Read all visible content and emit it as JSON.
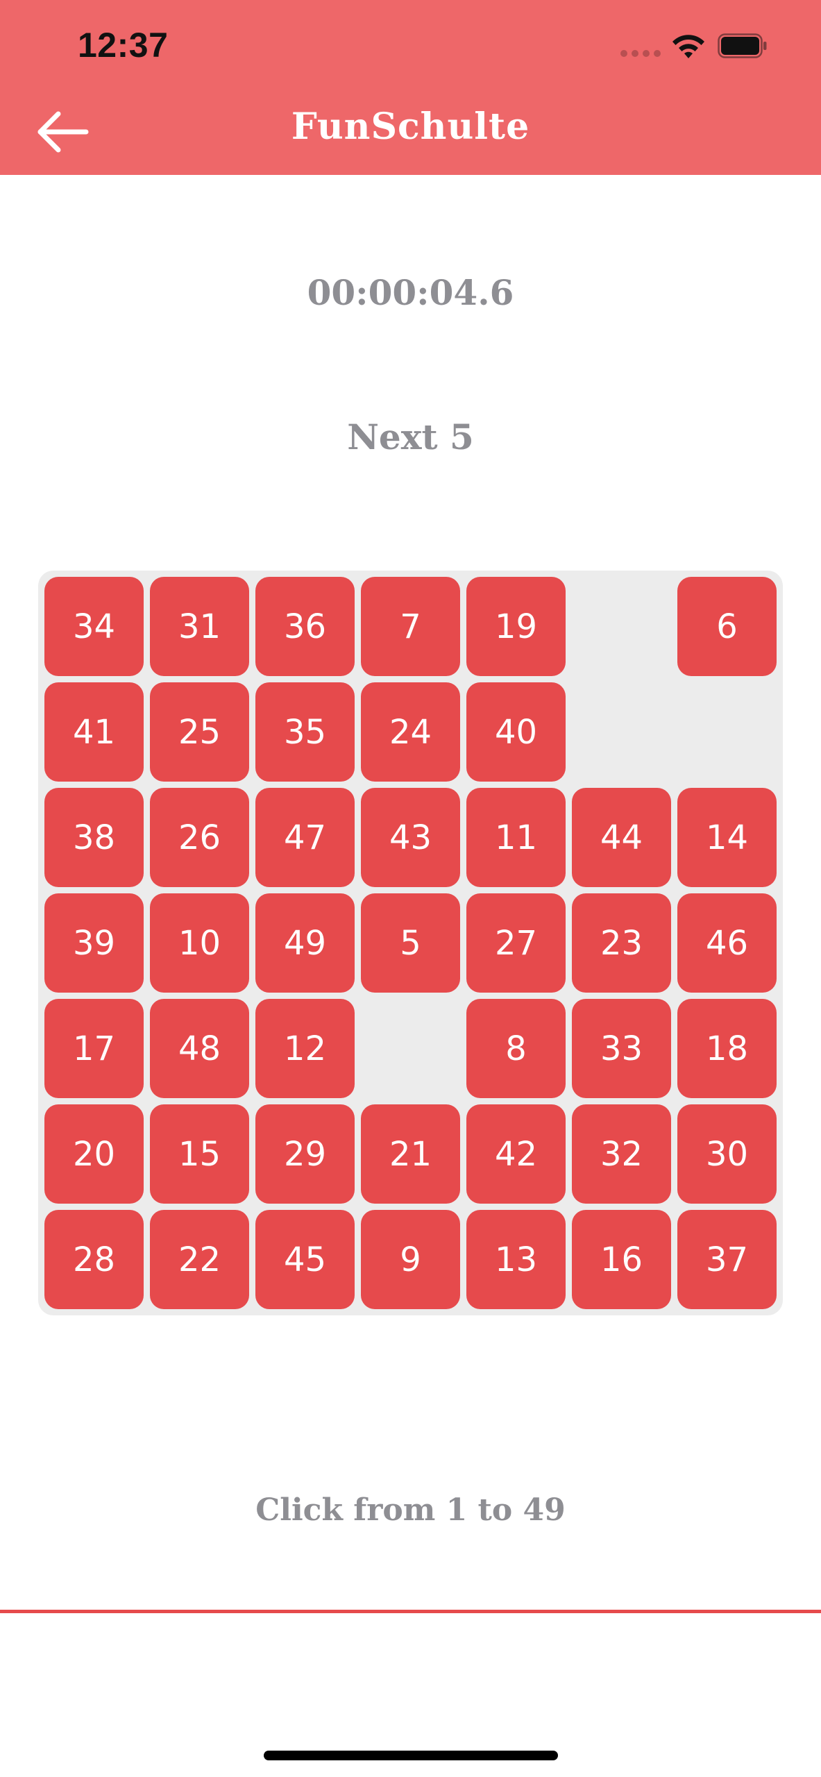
{
  "status_bar": {
    "time": "12:37"
  },
  "header": {
    "title": "FunSchulte",
    "background_color": "#EE6769",
    "back_icon": "arrow-left-icon"
  },
  "game": {
    "timer": "00:00:04.6",
    "next_label": "Next 5",
    "instruction": "Click from 1 to 49",
    "tile_color": "#E64A4C",
    "board_color": "#ECECEC",
    "grid_size": 7,
    "board": [
      [
        "34",
        "31",
        "36",
        "7",
        "19",
        "",
        "6"
      ],
      [
        "41",
        "25",
        "35",
        "24",
        "40",
        "",
        ""
      ],
      [
        "38",
        "26",
        "47",
        "43",
        "11",
        "44",
        "14"
      ],
      [
        "39",
        "10",
        "49",
        "5",
        "27",
        "23",
        "46"
      ],
      [
        "17",
        "48",
        "12",
        "",
        "8",
        "33",
        "18"
      ],
      [
        "20",
        "15",
        "29",
        "21",
        "42",
        "32",
        "30"
      ],
      [
        "28",
        "22",
        "45",
        "9",
        "13",
        "16",
        "37"
      ]
    ]
  }
}
